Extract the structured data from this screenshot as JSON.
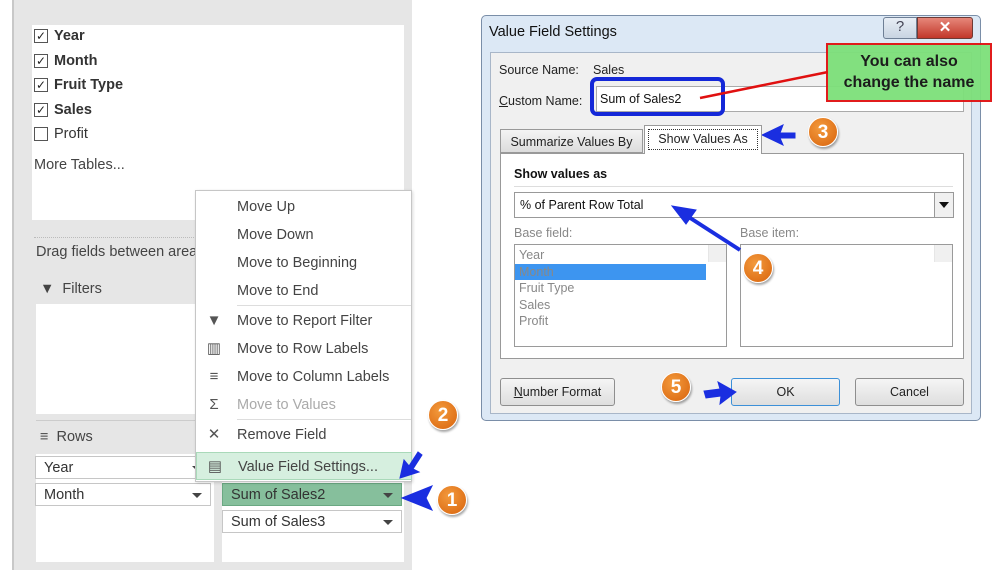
{
  "field_list": {
    "fields": [
      {
        "label": "Year",
        "checked": true
      },
      {
        "label": "Month",
        "checked": true
      },
      {
        "label": "Fruit Type",
        "checked": true
      },
      {
        "label": "Sales",
        "checked": true
      },
      {
        "label": "Profit",
        "checked": false
      }
    ],
    "more_tables": "More Tables..."
  },
  "areas": {
    "drag_hint": "Drag fields between areas",
    "filters_label": "Filters",
    "rows_label": "Rows",
    "rows": [
      "Year",
      "Month"
    ],
    "values": [
      "Sum of Sales2",
      "Sum of Sales3"
    ],
    "selected_value": "Sum of Sales2"
  },
  "context_menu": {
    "items": [
      {
        "label": "Move Up",
        "icon": "",
        "disabled": false
      },
      {
        "label": "Move Down",
        "icon": "",
        "disabled": false
      },
      {
        "label": "Move to Beginning",
        "icon": "",
        "disabled": false
      },
      {
        "label": "Move to End",
        "icon": "",
        "disabled": false
      },
      {
        "label": "Move to Report Filter",
        "icon": "filter-icon",
        "disabled": false
      },
      {
        "label": "Move to Row Labels",
        "icon": "row-labels-icon",
        "disabled": false
      },
      {
        "label": "Move to Column Labels",
        "icon": "column-labels-icon",
        "disabled": false
      },
      {
        "label": "Move to Values",
        "icon": "sigma-icon",
        "disabled": true
      },
      {
        "label": "Remove Field",
        "icon": "x-icon",
        "disabled": false
      },
      {
        "label": "Value Field Settings...",
        "icon": "field-settings-icon",
        "disabled": false,
        "highlighted": true
      }
    ]
  },
  "dialog": {
    "title": "Value Field Settings",
    "help": "?",
    "close": "✕",
    "source_name_label": "Source Name:",
    "source_name": "Sales",
    "custom_name_label": "Custom Name:",
    "custom_name": "Sum of Sales2",
    "tabs": [
      "Summarize Values By",
      "Show Values As"
    ],
    "active_tab": "Show Values As",
    "show_values_as_label": "Show values as",
    "show_values_as": "% of Parent Row Total",
    "base_field_label": "Base field:",
    "base_item_label": "Base item:",
    "base_fields": [
      "Year",
      "Month",
      "Fruit Type",
      "Sales",
      "Profit"
    ],
    "selected_base_field": "Month",
    "number_format": "Number Format",
    "ok": "OK",
    "cancel": "Cancel"
  },
  "annotations": {
    "callout": "You can also change the name",
    "steps": [
      "1",
      "2",
      "3",
      "4",
      "5"
    ],
    "colors": {
      "arrow": "#1a2ee0",
      "step": "#e07010",
      "callout_bg": "#7de07a",
      "callout_border": "#e01010"
    }
  }
}
